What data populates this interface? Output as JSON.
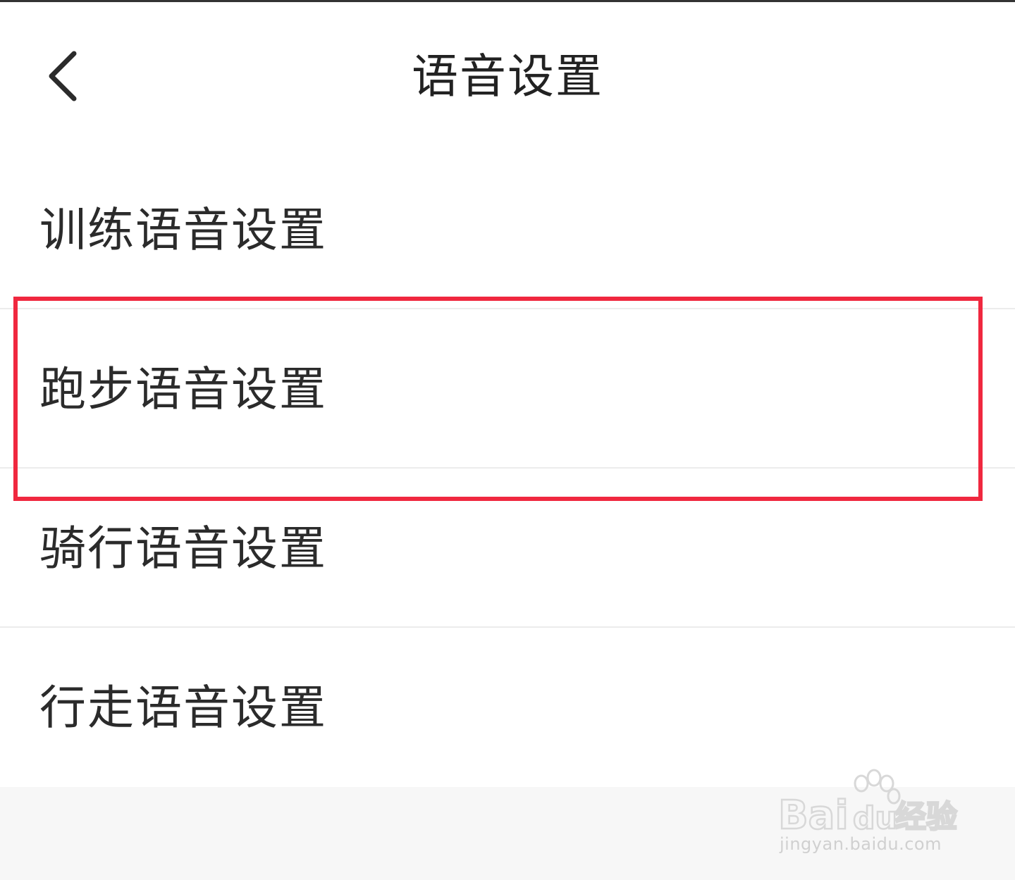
{
  "header": {
    "back_icon": "chevron-left-icon",
    "title": "语音设置"
  },
  "settings_list": [
    {
      "label": "训练语音设置"
    },
    {
      "label": "跑步语音设置",
      "highlighted": true
    },
    {
      "label": "骑行语音设置"
    },
    {
      "label": "行走语音设置"
    }
  ],
  "highlight_color": "#f0283f",
  "watermark": {
    "logo": "Bai du 经验",
    "url": "jingyan.baidu.com"
  }
}
